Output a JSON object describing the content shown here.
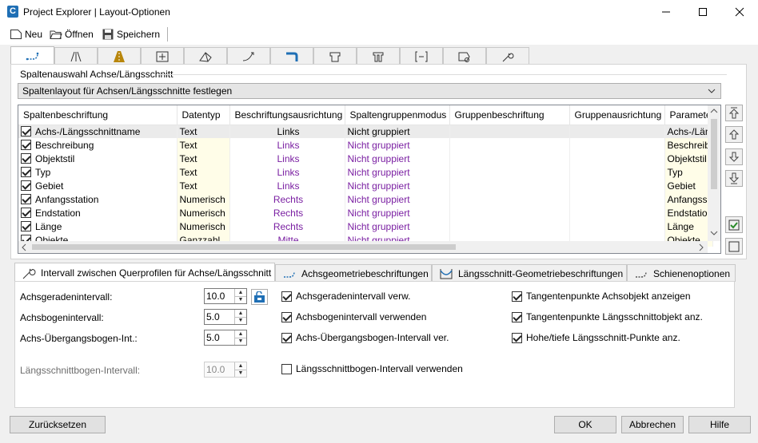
{
  "window": {
    "title": "Project Explorer | Layout-Optionen",
    "app_icon_letter": "C"
  },
  "toolbar": {
    "new_label": "Neu",
    "open_label": "Öffnen",
    "save_label": "Speichern"
  },
  "group": {
    "label": "Spaltenauswahl Achse/Längsschnitt"
  },
  "combo": {
    "value": "Spaltenlayout für Achsen/Längsschnitte festlegen"
  },
  "grid": {
    "headers": [
      "Spaltenbeschriftung",
      "Datentyp",
      "Beschriftungsausrichtung",
      "Spaltengruppenmodus",
      "Gruppenbeschriftung",
      "Gruppenausrichtung",
      "Paramete"
    ],
    "rows": [
      {
        "name": "Achs-/Längsschnittname",
        "type": "Text",
        "align": "Links",
        "mode": "Nicht gruppiert",
        "param": "Achs-/Län",
        "checked": true
      },
      {
        "name": "Beschreibung",
        "type": "Text",
        "align": "Links",
        "mode": "Nicht gruppiert",
        "param": "Beschreib",
        "checked": true
      },
      {
        "name": "Objektstil",
        "type": "Text",
        "align": "Links",
        "mode": "Nicht gruppiert",
        "param": "Objektstil",
        "checked": true
      },
      {
        "name": "Typ",
        "type": "Text",
        "align": "Links",
        "mode": "Nicht gruppiert",
        "param": "Typ",
        "checked": true
      },
      {
        "name": "Gebiet",
        "type": "Text",
        "align": "Links",
        "mode": "Nicht gruppiert",
        "param": "Gebiet",
        "checked": true
      },
      {
        "name": "Anfangsstation",
        "type": "Numerisch",
        "align": "Rechts",
        "mode": "Nicht gruppiert",
        "param": "Anfangss",
        "checked": true
      },
      {
        "name": "Endstation",
        "type": "Numerisch",
        "align": "Rechts",
        "mode": "Nicht gruppiert",
        "param": "Endstatio",
        "checked": true
      },
      {
        "name": "Länge",
        "type": "Numerisch",
        "align": "Rechts",
        "mode": "Nicht gruppiert",
        "param": "Länge",
        "checked": true
      },
      {
        "name": "Objekte",
        "type": "Ganzzahl",
        "align": "Mitte",
        "mode": "Nicht gruppiert",
        "param": "Objekte",
        "checked": true
      }
    ]
  },
  "bottom_tabs": [
    {
      "label": "Intervall zwischen Querprofilen für Achse/Längsschnitt"
    },
    {
      "label": "Achsgeometriebeschriftungen"
    },
    {
      "label": "Längsschnitt-Geometriebeschriftungen"
    },
    {
      "label": "Schienenoptionen"
    }
  ],
  "interval": {
    "straight": {
      "label": "Achsgeradenintervall:",
      "value": "10.0"
    },
    "arc": {
      "label": "Achsbogenintervall:",
      "value": "5.0"
    },
    "spiral": {
      "label": "Achs-Übergangsbogen-Int.:",
      "value": "5.0"
    },
    "profile_curve": {
      "label": "Längsschnittbogen-Intervall:",
      "value": "10.0"
    }
  },
  "checks": {
    "straight_use": {
      "label": "Achsgeradenintervall verw.",
      "checked": true
    },
    "arc_use": {
      "label": "Achsbogenintervall verwenden",
      "checked": true
    },
    "spiral_use": {
      "label": "Achs-Übergangsbogen-Intervall ver.",
      "checked": true
    },
    "profile_curve_use": {
      "label": "Längsschnittbogen-Intervall verwenden",
      "checked": false
    },
    "tangent_alignment": {
      "label": "Tangentenpunkte Achsobjekt anzeigen",
      "checked": true
    },
    "tangent_profile": {
      "label": "Tangentenpunkte Längsschnittobjekt anz.",
      "checked": true
    },
    "high_low": {
      "label": "Hohe/tiefe Längsschnitt-Punkte anz.",
      "checked": true
    }
  },
  "buttons": {
    "reset": "Zurücksetzen",
    "ok": "OK",
    "cancel": "Abbrechen",
    "help": "Hilfe"
  },
  "colors": {
    "purple_text": "#7a1fa2",
    "accent_blue": "#1f6fb5",
    "road_gold": "#b8860b"
  }
}
